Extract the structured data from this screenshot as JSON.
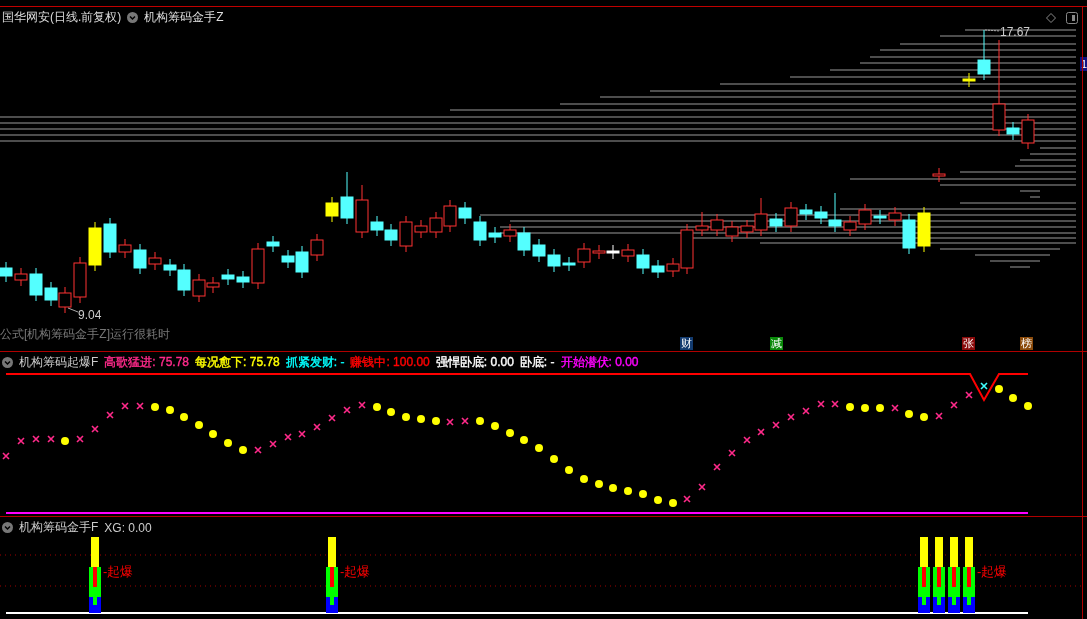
{
  "chart_header": {
    "stock": "国华网安(日线.前复权)",
    "indicator": "机构筹码金手Z"
  },
  "main_chart": {
    "high_label": "17.67",
    "low_label": "9.04",
    "notice": "公式[机构筹码金手Z]运行很耗时",
    "axis_tag": "1",
    "badges": [
      {
        "text": "财",
        "color": "#123a6e"
      },
      {
        "text": "减",
        "color": "#0a8a0a"
      },
      {
        "text": "张",
        "color": "#8a0a0a"
      },
      {
        "text": "榜",
        "color": "#8a4a0a"
      }
    ]
  },
  "indicator_pane": {
    "title": "机构筹码起爆F",
    "values": [
      {
        "label": "高歌猛进:",
        "value": "75.78",
        "color": "#ff2a8a"
      },
      {
        "label": "每况愈下:",
        "value": "75.78",
        "color": "#ffff00"
      },
      {
        "label": "抓紧发财:",
        "value": "-",
        "color": "#00ffff"
      },
      {
        "label": "赚钱中:",
        "value": "100.00",
        "color": "#ff0000"
      },
      {
        "label": "强悍卧底:",
        "value": "0.00",
        "color": "#ffffff"
      },
      {
        "label": "卧底:",
        "value": "-",
        "color": "#ffffff"
      },
      {
        "label": "开始潜伏:",
        "value": "0.00",
        "color": "#ff00ff"
      }
    ]
  },
  "signal_pane": {
    "title": "机构筹码金手F",
    "reading": "XG: 0.00",
    "markers": [
      "-起爆",
      "-起爆",
      "-起爆"
    ]
  }
}
